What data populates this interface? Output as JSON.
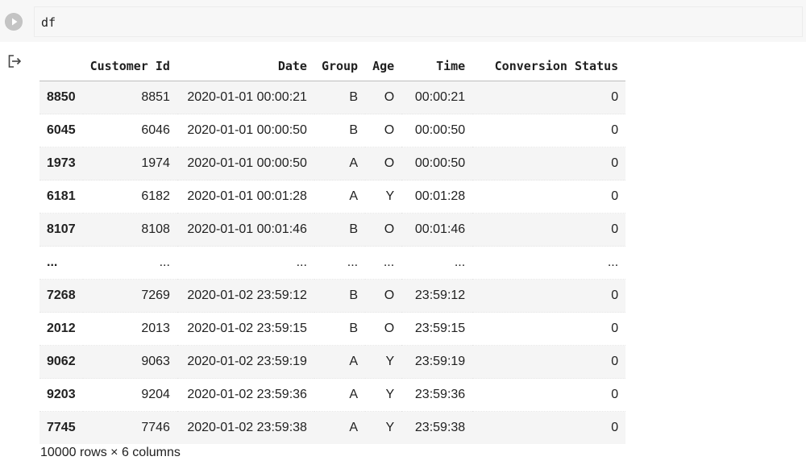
{
  "cell": {
    "code": "df",
    "run_icon": "play-icon"
  },
  "output": {
    "icon": "output-redirect-icon",
    "table": {
      "index_header": "",
      "columns": [
        "Customer Id",
        "Date",
        "Group",
        "Age",
        "Time",
        "Conversion Status"
      ],
      "rows": [
        {
          "index": "8850",
          "values": [
            "8851",
            "2020-01-01 00:00:21",
            "B",
            "O",
            "00:00:21",
            "0"
          ]
        },
        {
          "index": "6045",
          "values": [
            "6046",
            "2020-01-01 00:00:50",
            "B",
            "O",
            "00:00:50",
            "0"
          ]
        },
        {
          "index": "1973",
          "values": [
            "1974",
            "2020-01-01 00:00:50",
            "A",
            "O",
            "00:00:50",
            "0"
          ]
        },
        {
          "index": "6181",
          "values": [
            "6182",
            "2020-01-01 00:01:28",
            "A",
            "Y",
            "00:01:28",
            "0"
          ]
        },
        {
          "index": "8107",
          "values": [
            "8108",
            "2020-01-01 00:01:46",
            "B",
            "O",
            "00:01:46",
            "0"
          ]
        },
        {
          "index": "...",
          "values": [
            "...",
            "...",
            "...",
            "...",
            "...",
            "..."
          ]
        },
        {
          "index": "7268",
          "values": [
            "7269",
            "2020-01-02 23:59:12",
            "B",
            "O",
            "23:59:12",
            "0"
          ]
        },
        {
          "index": "2012",
          "values": [
            "2013",
            "2020-01-02 23:59:15",
            "B",
            "O",
            "23:59:15",
            "0"
          ]
        },
        {
          "index": "9062",
          "values": [
            "9063",
            "2020-01-02 23:59:19",
            "A",
            "Y",
            "23:59:19",
            "0"
          ]
        },
        {
          "index": "9203",
          "values": [
            "9204",
            "2020-01-02 23:59:36",
            "A",
            "Y",
            "23:59:36",
            "0"
          ]
        },
        {
          "index": "7745",
          "values": [
            "7746",
            "2020-01-02 23:59:38",
            "A",
            "Y",
            "23:59:38",
            "0"
          ]
        }
      ]
    },
    "shape": "10000 rows × 6 columns"
  },
  "colors": {
    "cell_background": "#f7f7f7",
    "stripe": "#f5f5f5",
    "run_button": "#bdbdbd"
  }
}
